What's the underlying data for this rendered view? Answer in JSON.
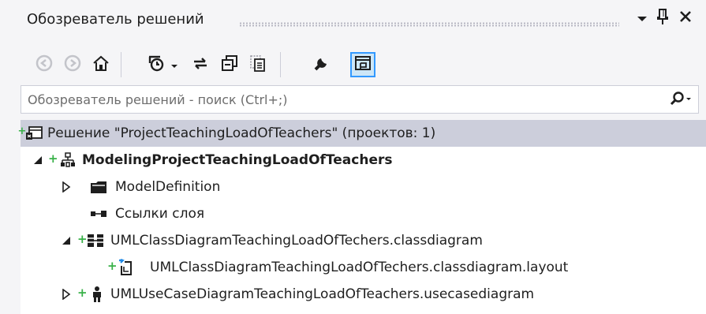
{
  "panel": {
    "title": "Обозреватель решений"
  },
  "search": {
    "placeholder": "Обозреватель решений - поиск (Ctrl+;)"
  },
  "tree": {
    "solution": {
      "label": "Решение \"ProjectTeachingLoadOfTeachers\"  (проектов: 1)"
    },
    "project": {
      "label": "ModelingProjectTeachingLoadOfTeachers"
    },
    "model_definition": {
      "label": "ModelDefinition"
    },
    "layer_refs": {
      "label": "Ссылки слоя"
    },
    "class_diagram": {
      "label": "UMLClassDiagramTeachingLoadOfTechers.classdiagram"
    },
    "class_layout": {
      "label": "UMLClassDiagramTeachingLoadOfTechers.classdiagram.layout"
    },
    "usecase_diagram": {
      "label": "UMLUseCaseDiagramTeachingLoadOfTeachers.usecasediagram"
    }
  },
  "icons": {
    "titlebar": [
      "dropdown-arrow-icon",
      "pin-icon",
      "close-icon"
    ],
    "toolbar": [
      "back-icon",
      "forward-icon",
      "home-icon",
      "pending-changes-icon",
      "dropdown-arrow-icon",
      "sync-icon",
      "collapse-all-icon",
      "show-all-files-icon",
      "properties-icon",
      "preview-icon"
    ],
    "tree": [
      "solution-icon",
      "modeling-project-icon",
      "folder-icon",
      "layer-refs-icon",
      "class-diagram-icon",
      "layout-file-icon",
      "usecase-actor-icon"
    ]
  },
  "colors": {
    "selection": "#cccedb",
    "source_control_plus": "#38b148",
    "active_tool_border": "#3399ff"
  }
}
